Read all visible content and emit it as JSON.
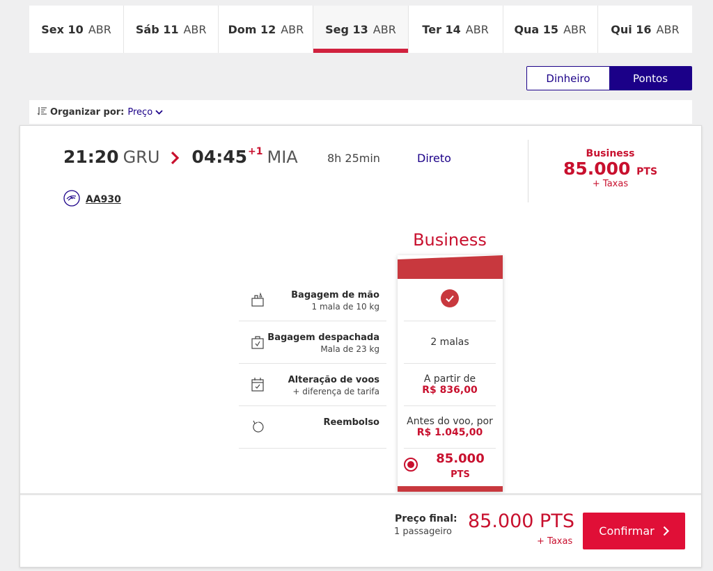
{
  "dates": [
    {
      "day": "Sex 10",
      "month": "ABR"
    },
    {
      "day": "Sáb 11",
      "month": "ABR"
    },
    {
      "day": "Dom 12",
      "month": "ABR"
    },
    {
      "day": "Seg 13",
      "month": "ABR",
      "active": true
    },
    {
      "day": "Ter 14",
      "month": "ABR"
    },
    {
      "day": "Qua 15",
      "month": "ABR"
    },
    {
      "day": "Qui 16",
      "month": "ABR"
    }
  ],
  "currency_toggle": {
    "money": "Dinheiro",
    "points": "Pontos",
    "selected": "Pontos"
  },
  "sort": {
    "label": "Organizar por:",
    "value": "Preço"
  },
  "flight": {
    "depart_time": "21:20",
    "depart_airport": "GRU",
    "arrive_time": "04:45",
    "day_offset": "+1",
    "arrive_airport": "MIA",
    "duration": "8h 25min",
    "stops": "Direto",
    "flight_number": "AA930",
    "price_class": "Business",
    "price_amount": "85.000",
    "price_unit": "PTS",
    "price_taxes": "+ Taxas"
  },
  "fare": {
    "title": "Business",
    "features": [
      {
        "title": "Bagagem de mão",
        "subtitle": "1 mala de 10 kg",
        "icon": "hand-baggage-icon"
      },
      {
        "title": "Bagagem despachada",
        "subtitle": "Mala de 23 kg",
        "icon": "checked-baggage-icon"
      },
      {
        "title": "Alteração de voos",
        "subtitle": "+ diferença de tarifa",
        "icon": "calendar-icon"
      },
      {
        "title": "Reembolso",
        "subtitle": "",
        "icon": "refund-icon"
      }
    ],
    "values": {
      "hand_baggage_icon": "check-circle-icon",
      "checked_baggage": "2 malas",
      "change_line1": "A partir de",
      "change_line2": "R$ 836,00",
      "refund_line1": "Antes do voo, por",
      "refund_line2": "R$ 1.045,00",
      "selected_amount": "85.000",
      "selected_unit": "PTS"
    }
  },
  "footer": {
    "label": "Preço final:",
    "passengers": "1 passageiro",
    "total": "85.000 PTS",
    "taxes": "+ Taxas",
    "confirm_label": "Confirmar"
  },
  "colors": {
    "brand_navy": "#1b0088",
    "brand_red": "#c8102e",
    "confirm": "#e00f37"
  }
}
